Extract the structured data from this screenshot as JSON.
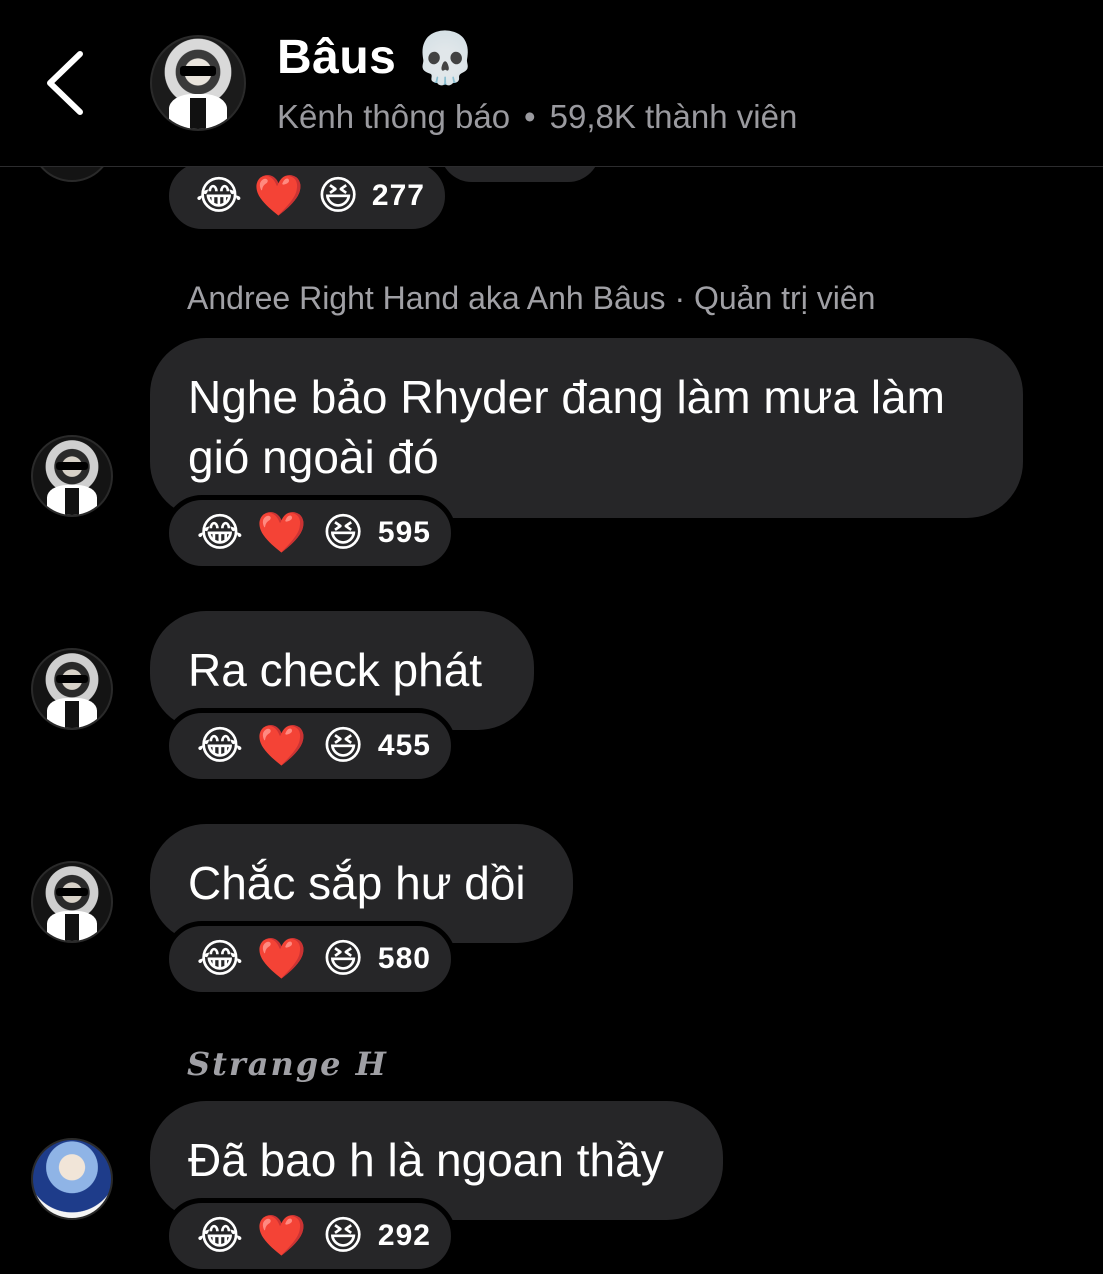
{
  "header": {
    "title": "Bâus",
    "title_emoji": "💀",
    "subtitle_channel": "Kênh thông báo",
    "separator": "•",
    "subtitle_members": "59,8K thành viên"
  },
  "reaction_emojis": {
    "laugh": "😂",
    "heart": "❤️",
    "grin": "😆"
  },
  "messages": [
    {
      "count": "277"
    },
    {
      "sender": "Andree Right Hand aka Anh Bâus · Quản trị viên",
      "text_line1": "Nghe bảo Rhyder đang làm mưa làm",
      "text_line2": "gió ngoài đó",
      "count": "595"
    },
    {
      "text": "Ra check phát",
      "count": "455"
    },
    {
      "text": "Chắc sắp hư dồi",
      "count": "580"
    },
    {
      "sender": "Strange H",
      "text": "Đã bao h là ngoan thầy",
      "count": "292"
    }
  ]
}
